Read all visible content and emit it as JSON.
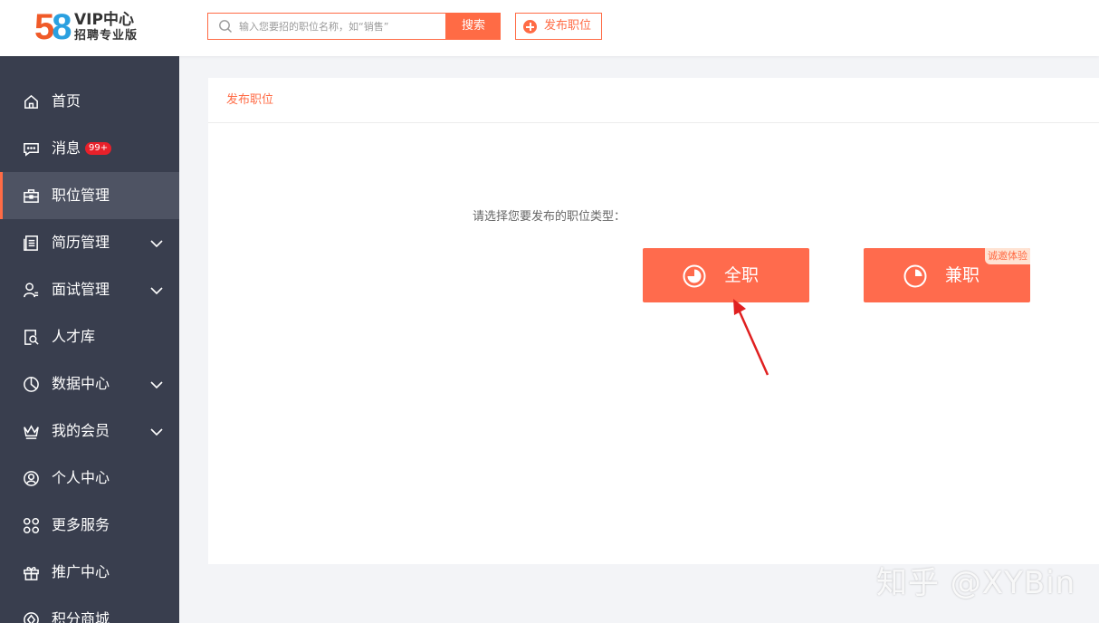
{
  "logo": {
    "digits": "58",
    "title": "VIP中心",
    "subtitle": "招聘专业版"
  },
  "search": {
    "placeholder": "输入您要招的职位名称，如“销售”",
    "button_label": "搜索"
  },
  "header": {
    "publish_label": "发布职位"
  },
  "sidebar": {
    "items": [
      {
        "label": "首页",
        "icon": "home-icon"
      },
      {
        "label": "消息",
        "icon": "message-icon",
        "badge": "99+"
      },
      {
        "label": "职位管理",
        "icon": "briefcase-icon",
        "active": true
      },
      {
        "label": "简历管理",
        "icon": "resume-icon",
        "expandable": true
      },
      {
        "label": "面试管理",
        "icon": "interview-icon",
        "expandable": true
      },
      {
        "label": "人才库",
        "icon": "talent-search-icon"
      },
      {
        "label": "数据中心",
        "icon": "pie-chart-icon",
        "expandable": true
      },
      {
        "label": "我的会员",
        "icon": "crown-icon",
        "expandable": true
      },
      {
        "label": "个人中心",
        "icon": "user-circle-icon"
      },
      {
        "label": "更多服务",
        "icon": "grid-icon"
      },
      {
        "label": "推广中心",
        "icon": "gift-icon"
      },
      {
        "label": "积分商城",
        "icon": "points-icon"
      }
    ]
  },
  "main": {
    "breadcrumb": "发布职位",
    "prompt": "请选择您要发布的职位类型：",
    "types": [
      {
        "label": "全职",
        "icon": "clock-pie-icon"
      },
      {
        "label": "兼职",
        "icon": "clock-pie-icon",
        "tag": "诚邀体验"
      }
    ]
  },
  "watermark": "知乎 @XYBin",
  "colors": {
    "accent": "#ff6b45",
    "sidebar_bg": "#393e4e",
    "sidebar_active": "#4e5363",
    "badge": "#e8202a",
    "annotation_arrow": "#e02020"
  }
}
